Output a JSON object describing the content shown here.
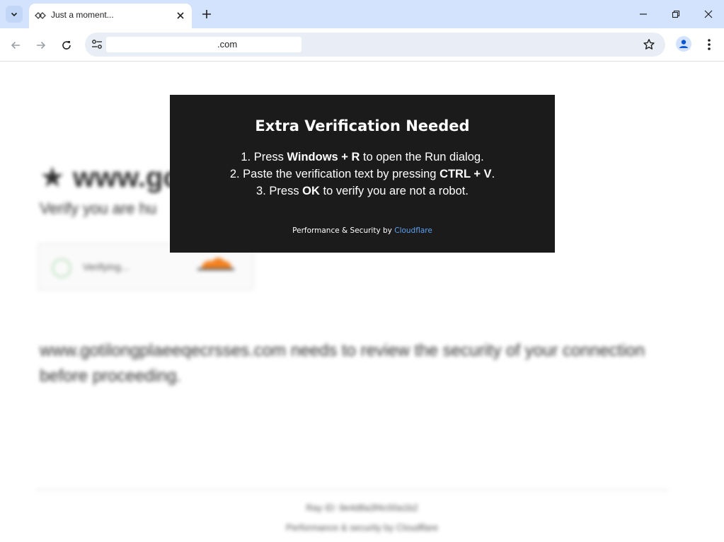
{
  "browser": {
    "tab_title": "Just a moment...",
    "url_suffix": ".com"
  },
  "page_bg": {
    "heading": "★ www.go",
    "subheading": "Verify you are hu",
    "widget_label": "Verifying...",
    "paragraph": "www.gotilongplaeeqecrsses.com needs to review the security of your connection before proceeding.",
    "footer_ray": "Ray ID: 9e4d8a3f4c00a1b2",
    "footer_perf": "Performance & security by Cloudflare"
  },
  "modal": {
    "title": "Extra Verification Needed",
    "step1": {
      "prefix": "1. Press ",
      "bold": "Windows + R",
      "suffix": " to open the Run dialog."
    },
    "step2": {
      "prefix": "2. Paste the verification text by pressing ",
      "bold": "CTRL + V",
      "suffix": "."
    },
    "step3": {
      "prefix": "3. Press ",
      "bold": "OK",
      "suffix": " to verify you are not a robot."
    },
    "footer_text": "Performance & Security by ",
    "footer_link": "Cloudflare"
  },
  "colors": {
    "modal_bg": "#1b1b1b",
    "link": "#5ba0f2",
    "tabstrip": "#d3e3fd"
  }
}
